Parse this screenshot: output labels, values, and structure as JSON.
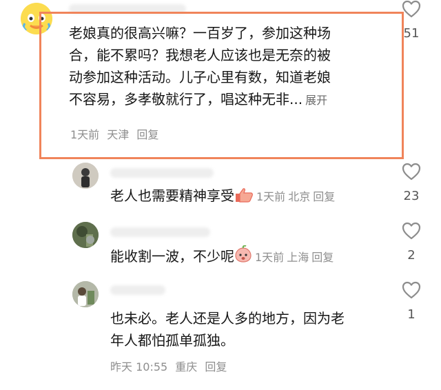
{
  "comments": [
    {
      "text": "老娘真的很高兴嘛？一百岁了，参加这种场合，能不累吗？我想老人应该也是无奈的被动参加这种活动。儿子心里有数，知道老娘不容易，多孝敬就行了，唱这种无非...",
      "line1": "老娘真的很高兴嘛？一百岁了，参加这种场",
      "line2": "合，能不累吗？我想老人应该也是无奈的被",
      "line3": "动参加这种活动。儿子心里有数，知道老娘",
      "line4": "不容易，多孝敬就行了，唱这种无非...",
      "expand": "展开",
      "time": "1天前",
      "location": "天津",
      "reply": "回复",
      "likes": "51",
      "avatar_icon": "emoji-face-icon"
    },
    {
      "text": "老人也需要精神享受",
      "time": "1天前",
      "location": "北京",
      "reply": "回复",
      "likes": "23",
      "emoji_icon": "thumbs-up-icon"
    },
    {
      "text": "能收割一波，不少呢",
      "time": "1天前",
      "location": "上海",
      "reply": "回复",
      "likes": "2",
      "emoji_icon": "peach-face-icon"
    },
    {
      "line1": "也未必。老人还是人多的地方，因为老",
      "line2": "年人都怕孤单孤独。",
      "time": "昨天 10:55",
      "location": "重庆",
      "reply": "回复",
      "likes": "1"
    }
  ],
  "colors": {
    "highlight_border": "#f0845a",
    "meta_text": "#8e8e8e",
    "body_text": "#161616"
  }
}
